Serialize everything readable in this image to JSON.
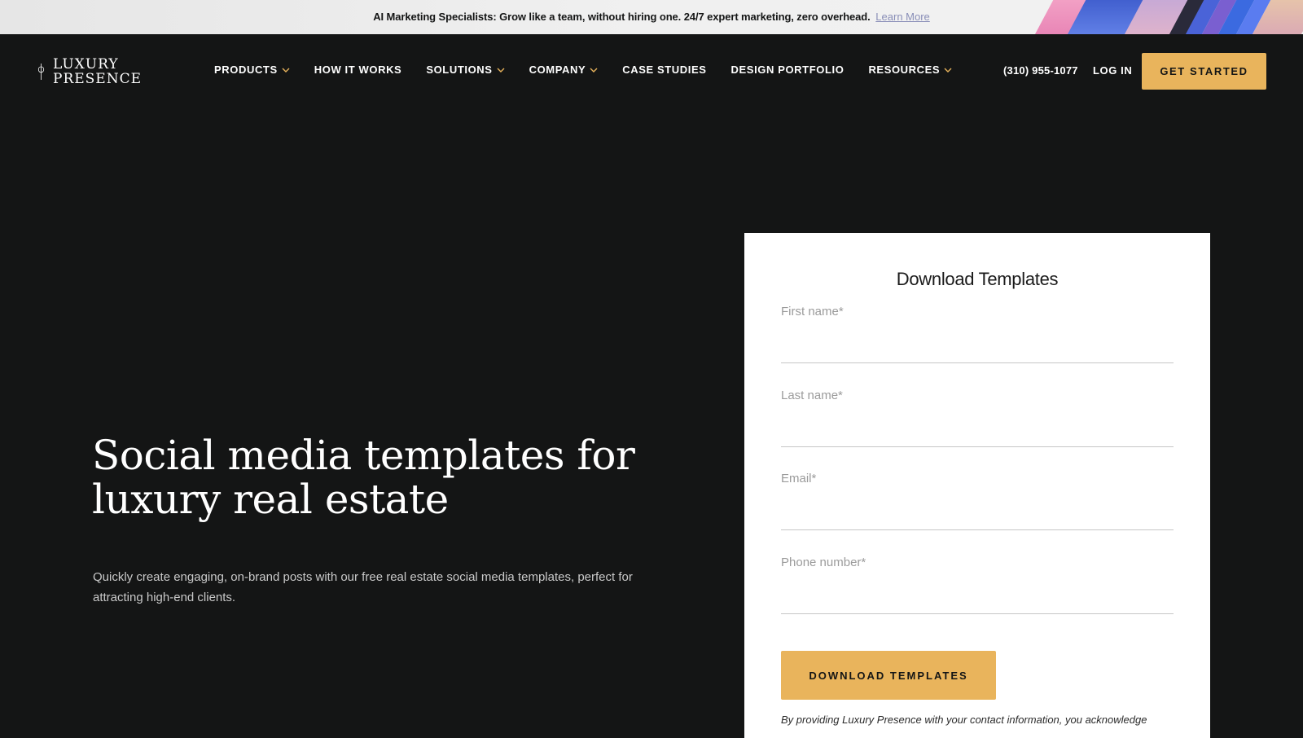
{
  "announcement": {
    "message": "AI Marketing Specialists: Grow like a team, without hiring one. 24/7 expert marketing, zero overhead.",
    "link_label": "Learn More"
  },
  "brand": {
    "name_line1": "LUXURY",
    "name_line2": "PRESENCE",
    "accent_color": "#e9b45c",
    "background_color": "#141515"
  },
  "nav": {
    "items": [
      {
        "label": "PRODUCTS",
        "has_dropdown": true
      },
      {
        "label": "HOW IT WORKS",
        "has_dropdown": false
      },
      {
        "label": "SOLUTIONS",
        "has_dropdown": true
      },
      {
        "label": "COMPANY",
        "has_dropdown": true
      },
      {
        "label": "CASE STUDIES",
        "has_dropdown": false
      },
      {
        "label": "DESIGN PORTFOLIO",
        "has_dropdown": false
      },
      {
        "label": "RESOURCES",
        "has_dropdown": true
      }
    ],
    "phone": "(310) 955-1077",
    "login_label": "LOG IN",
    "cta_label": "GET STARTED"
  },
  "hero": {
    "title_line1": "Social media templates for",
    "title_line2": "luxury real estate",
    "subtitle_line1": "Quickly create engaging, on-brand posts with our free real estate social media templates, perfect for",
    "subtitle_line2": "attracting high-end clients."
  },
  "form": {
    "title": "Download Templates",
    "fields": [
      {
        "label": "First name*",
        "value": ""
      },
      {
        "label": "Last name*",
        "value": ""
      },
      {
        "label": "Email*",
        "value": ""
      },
      {
        "label": "Phone number*",
        "value": ""
      }
    ],
    "submit_label": "DOWNLOAD TEMPLATES",
    "disclaimer": "By providing Luxury Presence with your contact information, you acknowledge"
  }
}
